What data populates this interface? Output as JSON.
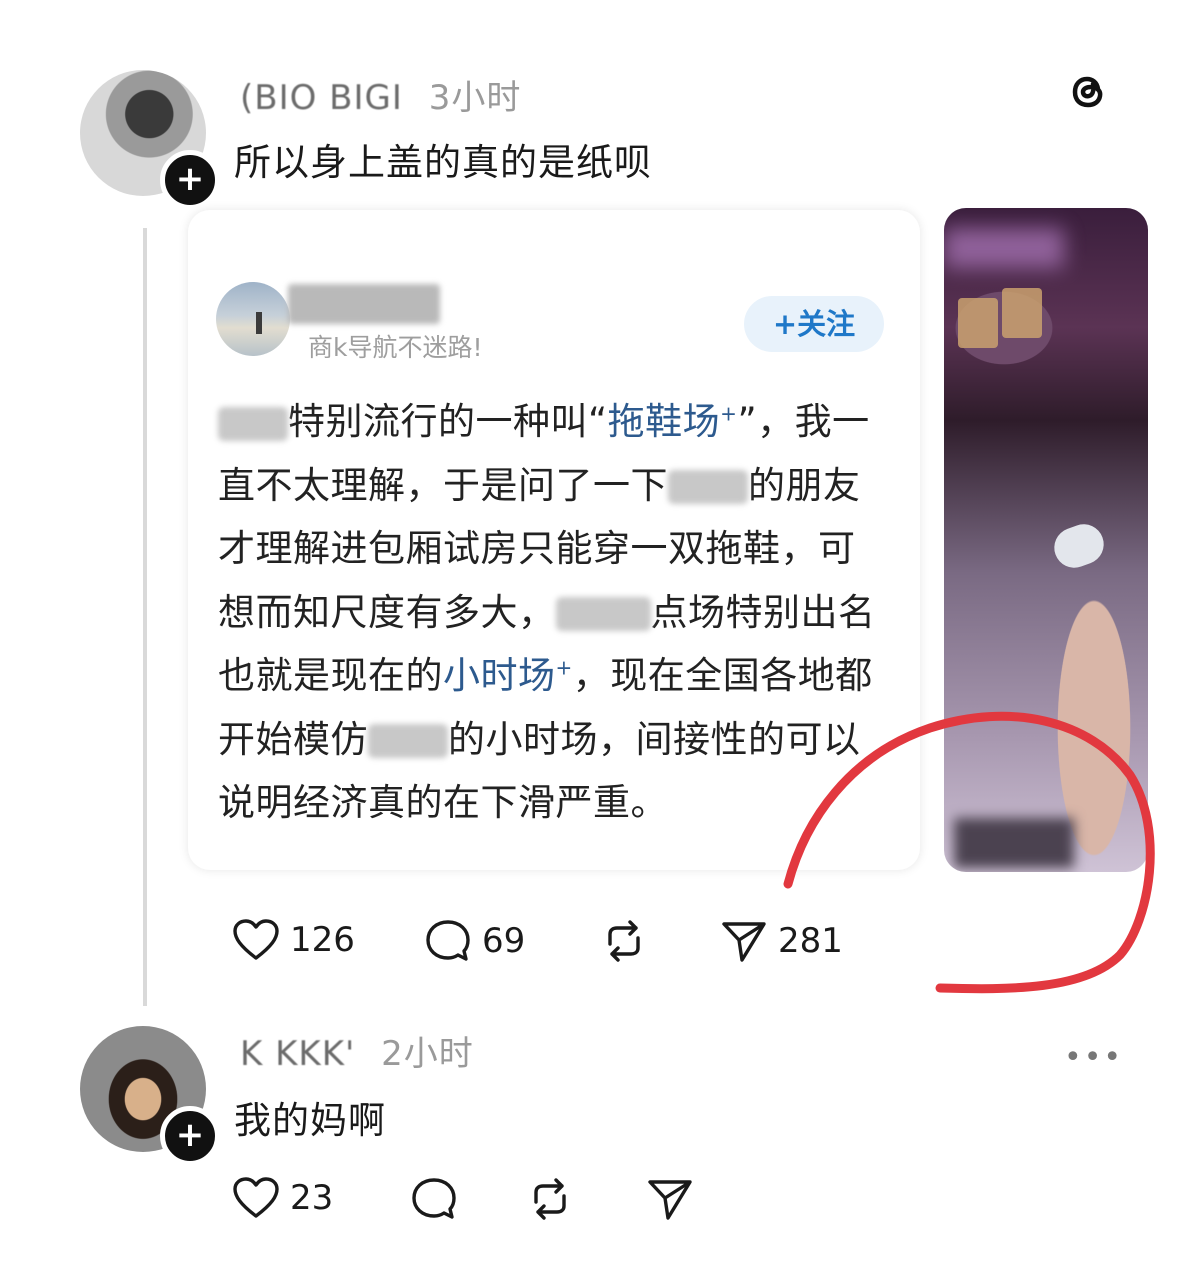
{
  "post1": {
    "author": "(BIO BIGI",
    "time": "3小时",
    "text": "所以身上盖的真的是纸呗"
  },
  "quoted": {
    "subtitle": "商k导航不迷路!",
    "follow_label": "+关注",
    "body": {
      "t1": "特别流行的一种叫“",
      "link1": "拖鞋场",
      "sup": "+",
      "t2": "”，我一直不太理解，于是问了一下",
      "t3": "的朋友才理解进包厢试房只能穿一双拖鞋，可想而知尺度有多大，",
      "t4": "点场特别出名也就是现在的",
      "link2": "小时场",
      "t5": "，现在全国各地都开始模仿",
      "t6": "的小时场，间接性的可以说明经济真的在下滑严重。"
    }
  },
  "post1_actions": {
    "likes": "126",
    "comments": "69",
    "shares": "281"
  },
  "post2": {
    "author": "K  KKK'",
    "time": "2小时",
    "text": "我的妈啊"
  },
  "post2_actions": {
    "likes": "23"
  },
  "colors": {
    "annotation_red": "#e2383f",
    "follow_blue": "#1f78c8",
    "link_blue": "#2d5a8e"
  },
  "icons": {
    "app": "threads-icon",
    "like": "heart-icon",
    "comment": "comment-bubble-icon",
    "repost": "repost-icon",
    "share": "send-icon",
    "more": "more-dots-icon",
    "follow": "plus-icon"
  }
}
